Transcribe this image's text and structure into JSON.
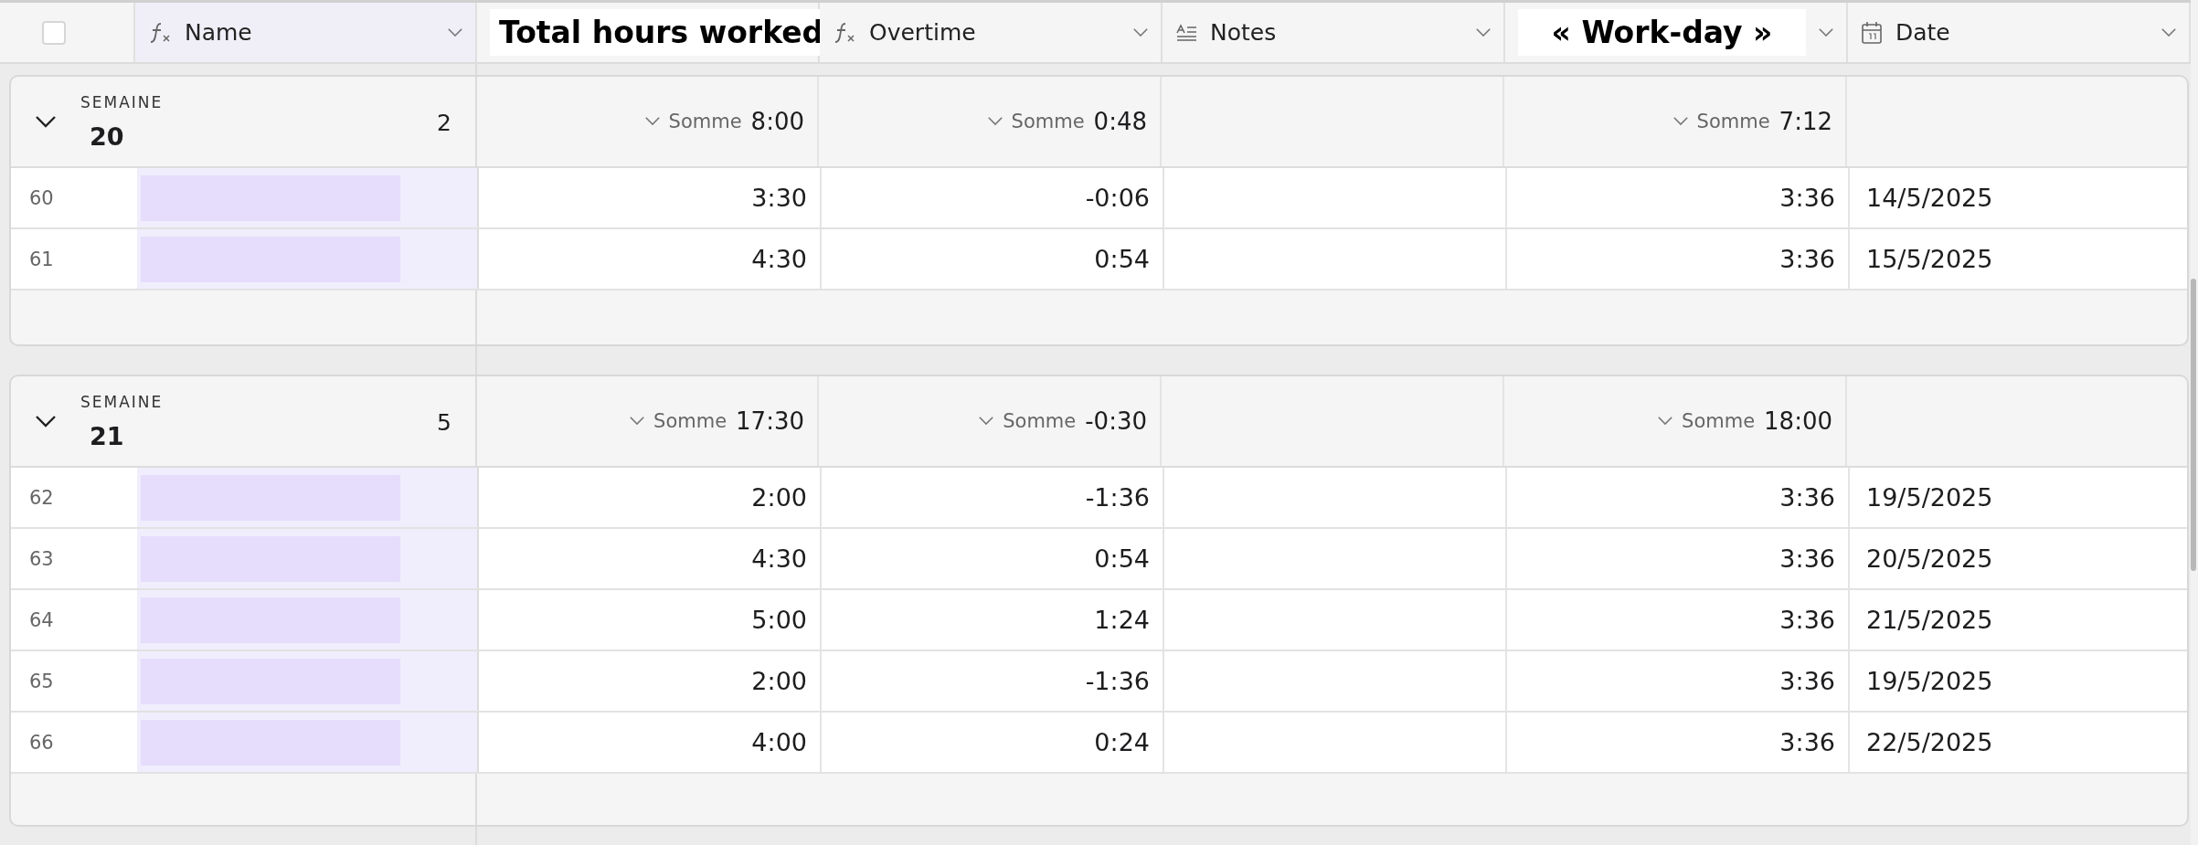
{
  "select_all": {
    "checked": false
  },
  "columns": [
    {
      "kind": "formula",
      "label": "Name",
      "highlighted": false,
      "chevron": true
    },
    {
      "kind": "plain",
      "label": "Total hours worked",
      "highlighted": true,
      "chevron": false
    },
    {
      "kind": "formula",
      "label": "Overtime",
      "highlighted": false,
      "chevron": true
    },
    {
      "kind": "long-text",
      "label": "Notes",
      "highlighted": false,
      "chevron": true
    },
    {
      "kind": "plain",
      "label": "« Work-day »",
      "highlighted": true,
      "chevron": true
    },
    {
      "kind": "date",
      "label": "Date",
      "highlighted": false,
      "chevron": true
    }
  ],
  "groups": [
    {
      "label": "SEMAINE",
      "value": "20",
      "count": "2",
      "expanded": true,
      "sums": {
        "total_hours": {
          "label": "Somme",
          "value": "8:00"
        },
        "overtime": {
          "label": "Somme",
          "value": "0:48"
        },
        "work_day": {
          "label": "Somme",
          "value": "7:12"
        }
      },
      "rows": [
        {
          "number": "60",
          "total_hours": "3:30",
          "overtime": "-0:06",
          "work_day": "3:36",
          "date": "14/5/2025"
        },
        {
          "number": "61",
          "total_hours": "4:30",
          "overtime": "0:54",
          "work_day": "3:36",
          "date": "15/5/2025"
        }
      ]
    },
    {
      "label": "SEMAINE",
      "value": "21",
      "count": "5",
      "expanded": true,
      "sums": {
        "total_hours": {
          "label": "Somme",
          "value": "17:30"
        },
        "overtime": {
          "label": "Somme",
          "value": "-0:30"
        },
        "work_day": {
          "label": "Somme",
          "value": "18:00"
        }
      },
      "rows": [
        {
          "number": "62",
          "total_hours": "2:00",
          "overtime": "-1:36",
          "work_day": "3:36",
          "date": "19/5/2025"
        },
        {
          "number": "63",
          "total_hours": "4:30",
          "overtime": "0:54",
          "work_day": "3:36",
          "date": "20/5/2025"
        },
        {
          "number": "64",
          "total_hours": "5:00",
          "overtime": "1:24",
          "work_day": "3:36",
          "date": "21/5/2025"
        },
        {
          "number": "65",
          "total_hours": "2:00",
          "overtime": "-1:36",
          "work_day": "3:36",
          "date": "19/5/2025"
        },
        {
          "number": "66",
          "total_hours": "4:00",
          "overtime": "0:24",
          "work_day": "3:36",
          "date": "22/5/2025"
        }
      ]
    }
  ]
}
